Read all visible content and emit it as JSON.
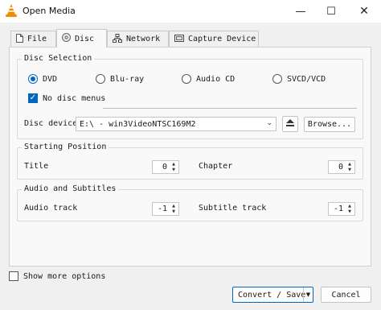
{
  "window": {
    "title": "Open Media",
    "minimize": "—",
    "maximize": "☐",
    "close": "✕"
  },
  "tabs": [
    {
      "label": "File",
      "icon": "file-icon"
    },
    {
      "label": "Disc",
      "icon": "disc-icon"
    },
    {
      "label": "Network",
      "icon": "network-icon"
    },
    {
      "label": "Capture Device",
      "icon": "capture-device-icon"
    }
  ],
  "disc_selection": {
    "title": "Disc Selection",
    "options": [
      "DVD",
      "Blu-ray",
      "Audio CD",
      "SVCD/VCD"
    ],
    "selected": "DVD",
    "no_disc_menus_label": "No disc menus",
    "no_disc_menus_checked": true,
    "device_label": "Disc device",
    "device_value": "E:\\ - win3VideoNTSC169M2",
    "eject_icon": "eject-icon",
    "browse_label": "Browse..."
  },
  "starting_position": {
    "title": "Starting Position",
    "title_label": "Title",
    "title_value": "0",
    "chapter_label": "Chapter",
    "chapter_value": "0"
  },
  "audio_subtitles": {
    "title": "Audio and Subtitles",
    "audio_label": "Audio track",
    "audio_value": "-1",
    "subtitle_label": "Subtitle track",
    "subtitle_value": "-1"
  },
  "footer": {
    "show_more_label": "Show more options",
    "show_more_checked": false,
    "convert_label": "Convert / Save",
    "cancel_label": "Cancel"
  },
  "colors": {
    "accent": "#0067c0",
    "vlc_orange": "#f08c00"
  }
}
